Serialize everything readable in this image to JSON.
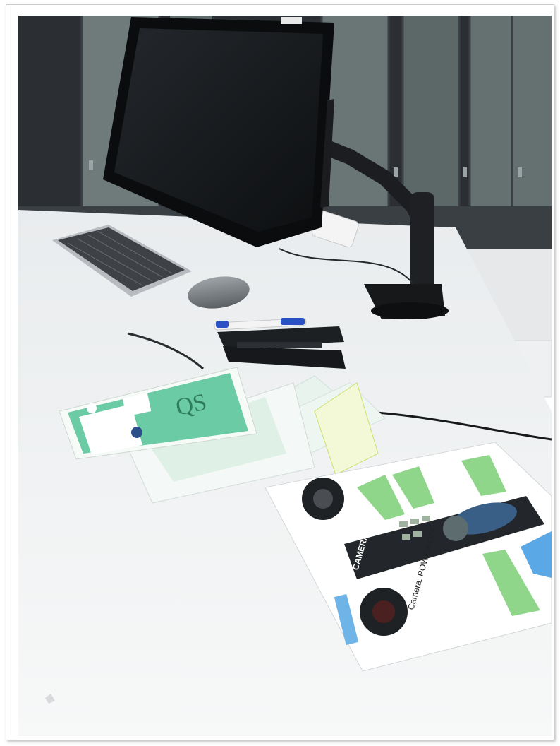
{
  "photo": {
    "description_free": true,
    "visible_labels": {
      "qs_cover_text": "QS",
      "remote_brand": "CAMERA",
      "guide_caption": "Camera: POWER OFF"
    }
  },
  "colors": {
    "wall": "#2f3338",
    "desk": "#f1f2f3",
    "monitor": "#131517",
    "card_green": "#6bcba4",
    "arrow_green": "#8fd68a",
    "arrow_blue": "#5aa9e6",
    "remote_body": "#23272b"
  }
}
